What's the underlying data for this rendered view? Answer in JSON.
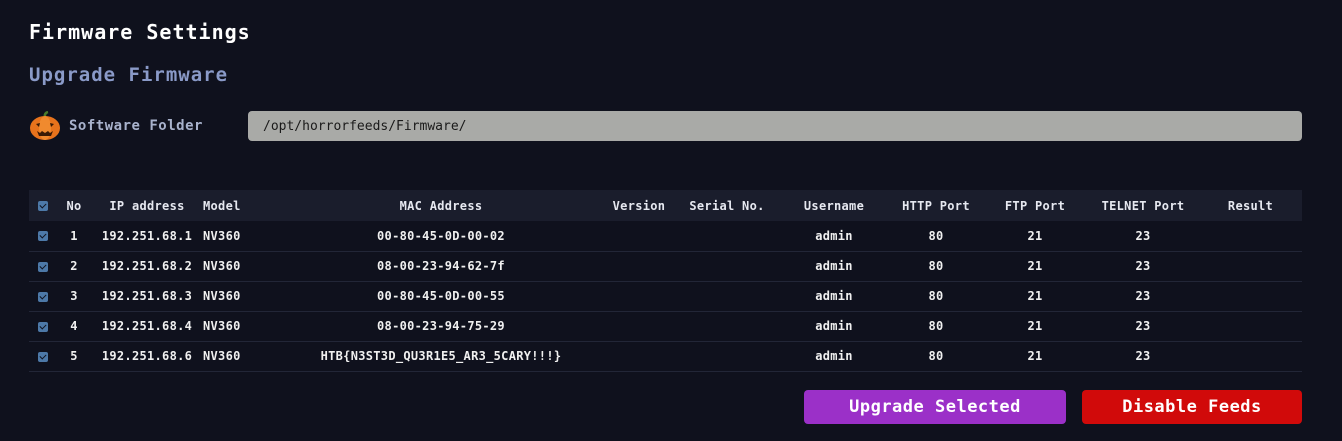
{
  "page": {
    "title": "Firmware Settings",
    "section_title": "Upgrade Firmware"
  },
  "folder": {
    "icon": "pumpkin-icon",
    "label": "Software Folder",
    "value": "/opt/horrorfeeds/Firmware/"
  },
  "table": {
    "columns": [
      "No",
      "IP address",
      "Model",
      "MAC Address",
      "Version",
      "Serial No.",
      "Username",
      "HTTP Port",
      "FTP Port",
      "TELNET Port",
      "Result"
    ],
    "rows": [
      {
        "checked": true,
        "no": "1",
        "ip": "192.251.68.1",
        "model": "NV360",
        "mac": "00-80-45-0D-00-02",
        "version": "",
        "serial": "",
        "username": "admin",
        "http": "80",
        "ftp": "21",
        "telnet": "23",
        "result": ""
      },
      {
        "checked": true,
        "no": "2",
        "ip": "192.251.68.2",
        "model": "NV360",
        "mac": "08-00-23-94-62-7f",
        "version": "",
        "serial": "",
        "username": "admin",
        "http": "80",
        "ftp": "21",
        "telnet": "23",
        "result": ""
      },
      {
        "checked": true,
        "no": "3",
        "ip": "192.251.68.3",
        "model": "NV360",
        "mac": "00-80-45-0D-00-55",
        "version": "",
        "serial": "",
        "username": "admin",
        "http": "80",
        "ftp": "21",
        "telnet": "23",
        "result": ""
      },
      {
        "checked": true,
        "no": "4",
        "ip": "192.251.68.4",
        "model": "NV360",
        "mac": "08-00-23-94-75-29",
        "version": "",
        "serial": "",
        "username": "admin",
        "http": "80",
        "ftp": "21",
        "telnet": "23",
        "result": ""
      },
      {
        "checked": true,
        "no": "5",
        "ip": "192.251.68.6",
        "model": "NV360",
        "mac": "HTB{N3ST3D_QU3R1E5_AR3_5CARY!!!}",
        "version": "",
        "serial": "",
        "username": "admin",
        "http": "80",
        "ftp": "21",
        "telnet": "23",
        "result": ""
      }
    ]
  },
  "actions": {
    "upgrade_label": "Upgrade Selected",
    "disable_label": "Disable Feeds"
  },
  "colors": {
    "background": "#0f111d",
    "upgrade_button": "#9b30c8",
    "disable_button": "#d10a0a",
    "section_title": "#8a9ac8"
  }
}
